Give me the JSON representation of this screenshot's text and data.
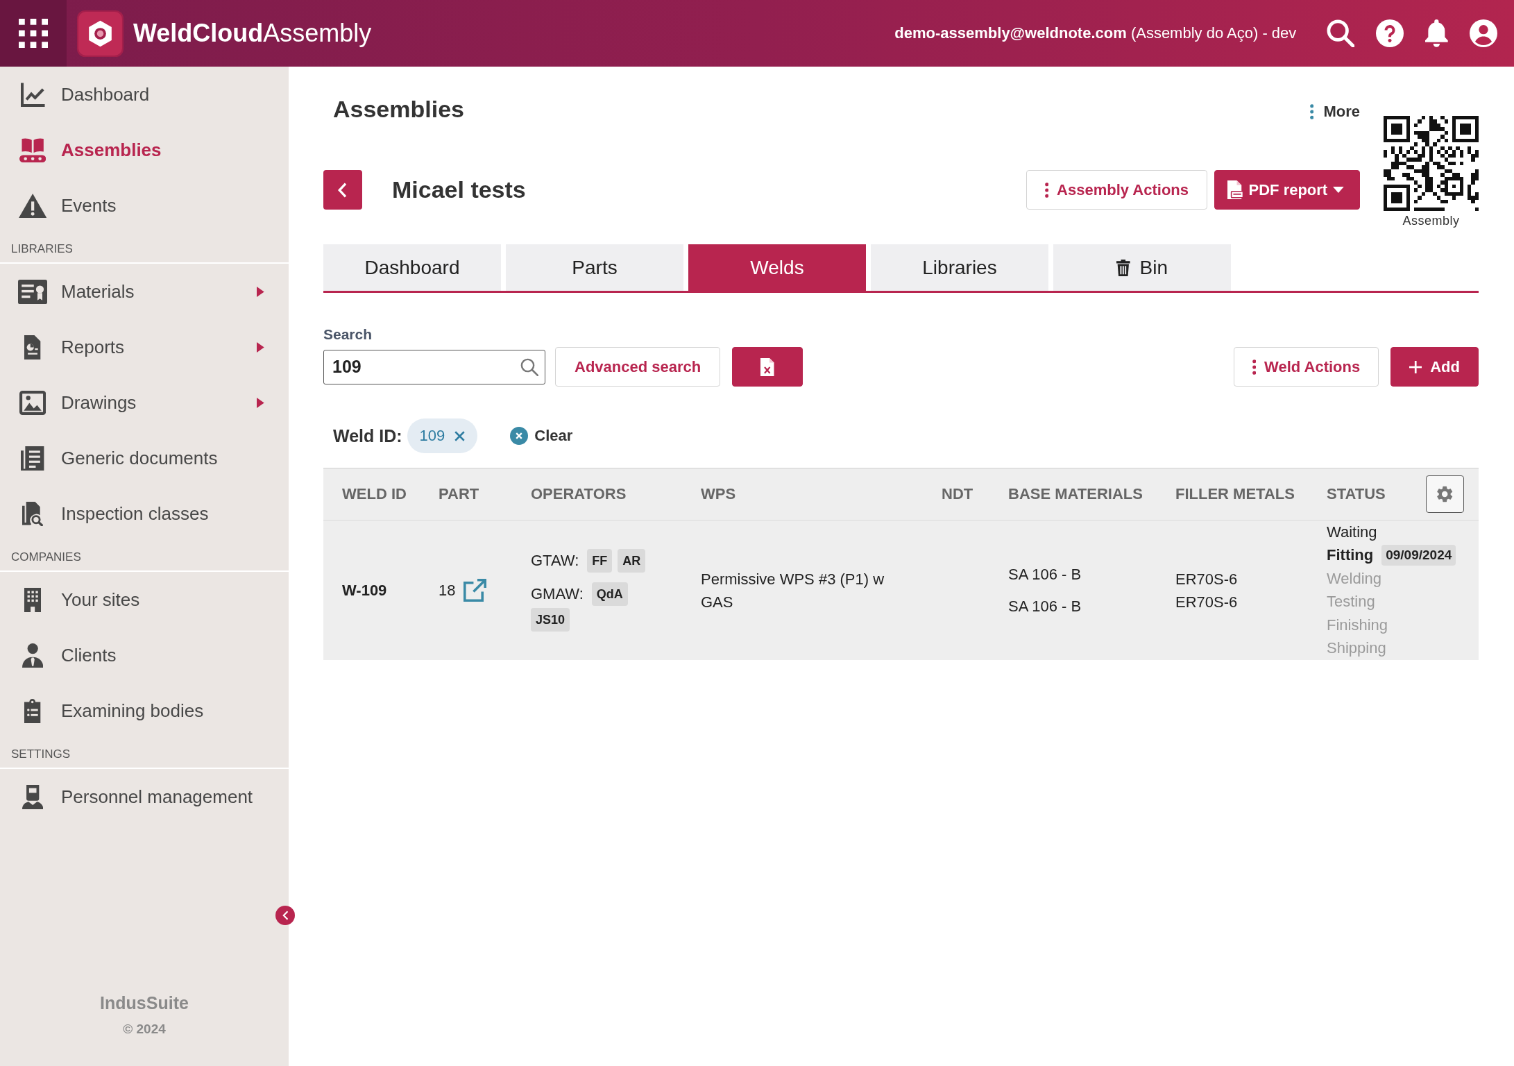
{
  "header": {
    "brand": "**WeldCloud**Assembly",
    "account": "**demo-assembly@weldnote.com** (Assembly do Aço) - dev"
  },
  "sidebar": {
    "sections": [
      {
        "items": [
          {
            "label": "Dashboard",
            "kind": "link",
            "selected": false
          },
          {
            "label": "Assemblies",
            "kind": "link",
            "selected": true
          },
          {
            "label": "Events",
            "kind": "link",
            "selected": false
          }
        ]
      },
      {
        "heading": "LIBRARIES",
        "items": [
          {
            "label": "Materials",
            "kind": "submenu",
            "selected": false
          },
          {
            "label": "Reports",
            "kind": "submenu",
            "selected": false
          },
          {
            "label": "Drawings",
            "kind": "submenu",
            "selected": false
          },
          {
            "label": "Generic documents",
            "kind": "link",
            "selected": false
          },
          {
            "label": "Inspection classes",
            "kind": "link",
            "selected": false
          }
        ]
      },
      {
        "heading": "COMPANIES",
        "items": [
          {
            "label": "Your sites",
            "kind": "link",
            "selected": false
          },
          {
            "label": "Clients",
            "kind": "link",
            "selected": false
          },
          {
            "label": "Examining bodies",
            "kind": "link",
            "selected": false
          }
        ]
      },
      {
        "heading": "SETTINGS",
        "items": [
          {
            "label": "Personnel management",
            "kind": "link",
            "selected": false
          }
        ]
      }
    ],
    "footer": {
      "brand": "IndusSuite",
      "copyright": "© 2024"
    }
  },
  "page": {
    "title": "Assemblies",
    "more": "More",
    "qr_caption": "Assembly"
  },
  "assembly": {
    "name": "Micael tests",
    "actions_button": "Assembly Actions",
    "report_button": "PDF report"
  },
  "tabs": [
    {
      "label": "Dashboard",
      "selected": false
    },
    {
      "label": "Parts",
      "selected": false
    },
    {
      "label": "Welds",
      "selected": true
    },
    {
      "label": "Libraries",
      "selected": false
    },
    {
      "label": "Bin",
      "selected": false
    }
  ],
  "search": {
    "label": "Search",
    "value": "109",
    "advanced_button": "Advanced search"
  },
  "weld_actions_button": "Weld Actions",
  "add_button": "Add",
  "filters": {
    "label": "Weld ID:",
    "chips": [
      "109"
    ],
    "clear": "Clear"
  },
  "table": {
    "columns": [
      "WELD ID",
      "PART",
      "OPERATORS",
      "WPS",
      "NDT",
      "BASE MATERIALS",
      "FILLER METALS",
      "STATUS"
    ],
    "rows": [
      {
        "weld_id": "W-109",
        "part": "18",
        "operators": [
          {
            "process": "GTAW:",
            "welders": [
              "FF",
              "AR"
            ]
          },
          {
            "process": "GMAW:",
            "welders": [
              "QdA",
              "JS10"
            ]
          }
        ],
        "wps": "Permissive WPS #3 (P1) w GAS",
        "base_materials": [
          "SA 106 - B",
          "SA 106 - B"
        ],
        "filler_metals": [
          "ER70S-6",
          "ER70S-6"
        ],
        "status": [
          {
            "label": "Waiting",
            "reached": true,
            "current": false
          },
          {
            "label": "Fitting",
            "reached": true,
            "current": true,
            "date": "09/09/2024"
          },
          {
            "label": "Welding",
            "reached": false,
            "current": false
          },
          {
            "label": "Testing",
            "reached": false,
            "current": false
          },
          {
            "label": "Finishing",
            "reached": false,
            "current": false
          },
          {
            "label": "Shipping",
            "reached": false,
            "current": false
          }
        ]
      }
    ]
  }
}
